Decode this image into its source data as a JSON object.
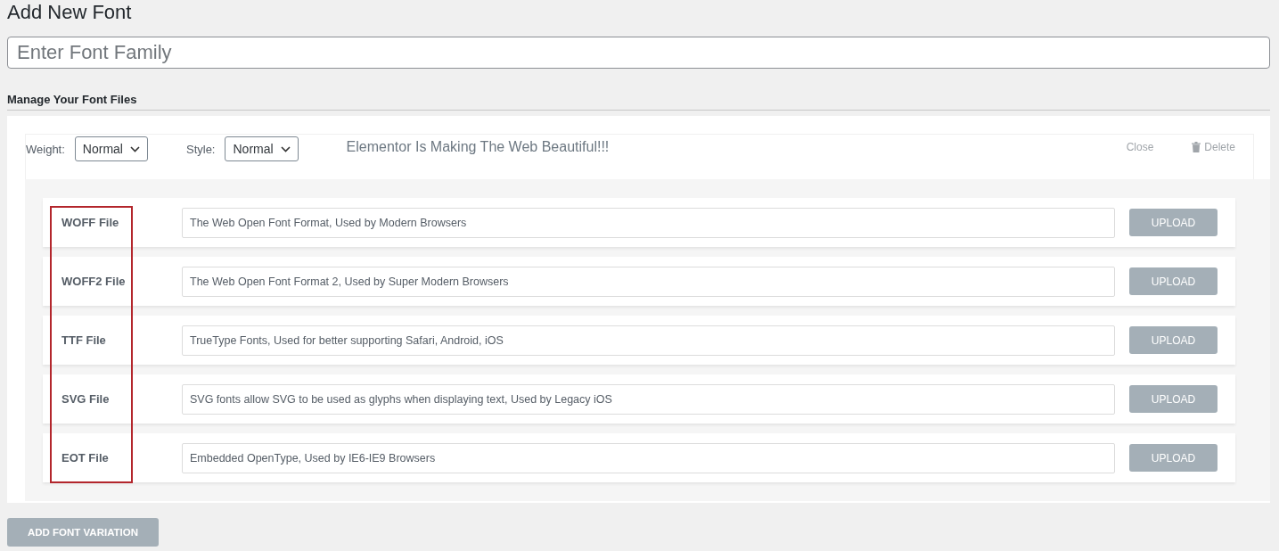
{
  "page": {
    "title": "Add New Font"
  },
  "font_family": {
    "placeholder": "Enter Font Family"
  },
  "section": {
    "title": "Manage Your Font Files"
  },
  "variation": {
    "weight": {
      "label": "Weight:",
      "value": "Normal"
    },
    "style": {
      "label": "Style:",
      "value": "Normal"
    },
    "preview": "Elementor Is Making The Web Beautiful!!!",
    "close": "Close",
    "delete": "Delete",
    "files": [
      {
        "label": "WOFF File",
        "placeholder": "The Web Open Font Format, Used by Modern Browsers",
        "button": "UPLOAD"
      },
      {
        "label": "WOFF2 File",
        "placeholder": "The Web Open Font Format 2, Used by Super Modern Browsers",
        "button": "UPLOAD"
      },
      {
        "label": "TTF File",
        "placeholder": "TrueType Fonts, Used for better supporting Safari, Android, iOS",
        "button": "UPLOAD"
      },
      {
        "label": "SVG File",
        "placeholder": "SVG fonts allow SVG to be used as glyphs when displaying text, Used by Legacy iOS",
        "button": "UPLOAD"
      },
      {
        "label": "EOT File",
        "placeholder": "Embedded OpenType, Used by IE6-IE9 Browsers",
        "button": "UPLOAD"
      }
    ]
  },
  "add_button": "ADD FONT VARIATION"
}
